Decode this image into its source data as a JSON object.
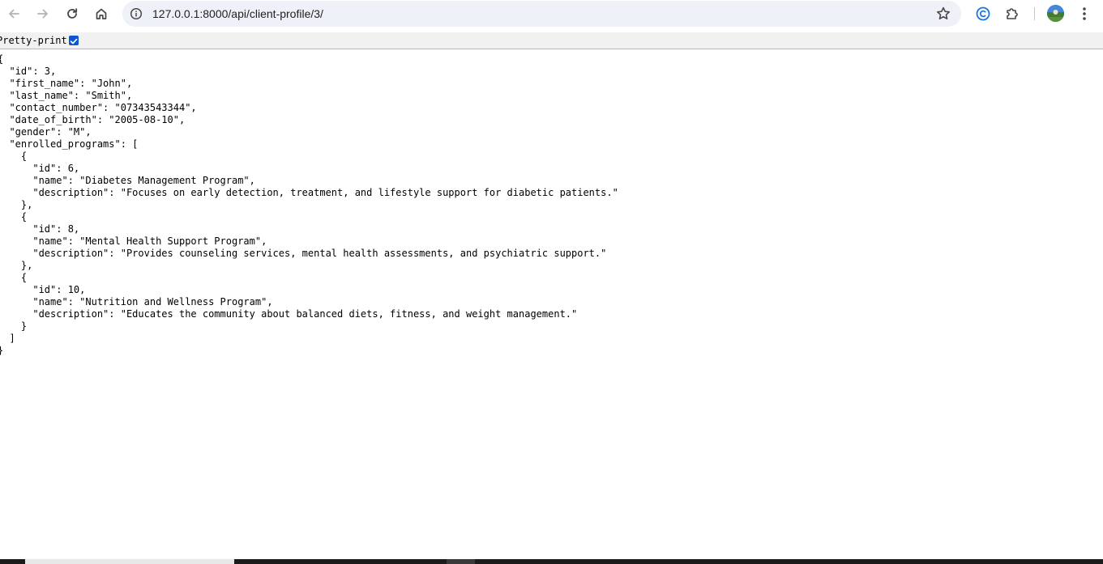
{
  "browser": {
    "url": "127.0.0.1:8000/api/client-profile/3/",
    "icons": {
      "back": "arrow-left-icon",
      "forward": "arrow-right-icon",
      "reload": "reload-icon",
      "home": "home-icon",
      "site_info": "info-icon",
      "bookmark": "star-icon",
      "extension_c": "copyright-c-icon",
      "extensions": "puzzle-icon",
      "profile": "avatar",
      "menu": "kebab-menu-icon"
    },
    "accent_color": "#0b57d0"
  },
  "pretty_print": {
    "label": "Pretty-print",
    "checked": true
  },
  "json_lines": [
    "{",
    "  \"id\": 3,",
    "  \"first_name\": \"John\",",
    "  \"last_name\": \"Smith\",",
    "  \"contact_number\": \"07343543344\",",
    "  \"date_of_birth\": \"2005-08-10\",",
    "  \"gender\": \"M\",",
    "  \"enrolled_programs\": [",
    "    {",
    "      \"id\": 6,",
    "      \"name\": \"Diabetes Management Program\",",
    "      \"description\": \"Focuses on early detection, treatment, and lifestyle support for diabetic patients.\"",
    "    },",
    "    {",
    "      \"id\": 8,",
    "      \"name\": \"Mental Health Support Program\",",
    "      \"description\": \"Provides counseling services, mental health assessments, and psychiatric support.\"",
    "    },",
    "    {",
    "      \"id\": 10,",
    "      \"name\": \"Nutrition and Wellness Program\",",
    "      \"description\": \"Educates the community about balanced diets, fitness, and weight management.\"",
    "    }",
    "  ]",
    "}"
  ]
}
